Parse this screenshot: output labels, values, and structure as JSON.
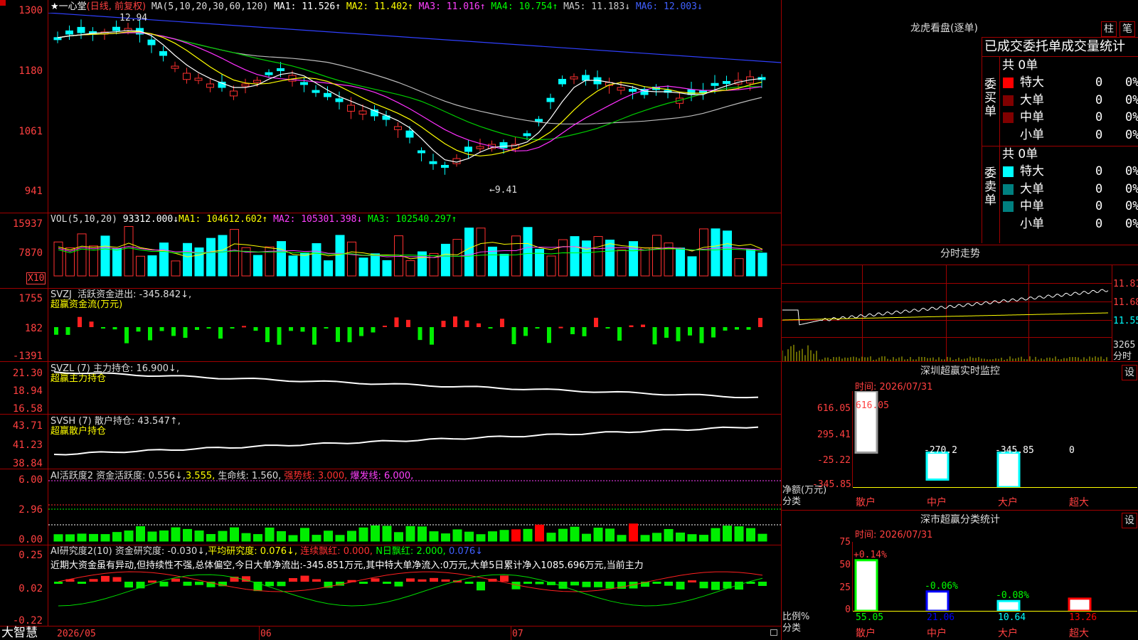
{
  "app_logo": "大智慧",
  "kline": {
    "stock": "★一心堂",
    "period": "(日线, 前复权)",
    "ma_label": "MA(5,10,20,30,60,120)",
    "ma1": "MA1: 11.526↑",
    "ma2": "MA2: 11.402↑",
    "ma3": "MA3: 11.016↑",
    "ma4": "MA4: 10.754↑",
    "ma5": "MA5: 11.183↓",
    "ma6": "MA6: 12.003↓",
    "high_mark": "12.94",
    "low_mark": "←9.41",
    "y_ticks": [
      "1300",
      "1180",
      "1061",
      "941"
    ]
  },
  "vol": {
    "label": "VOL(5,10,20)",
    "value": "93312.000↓",
    "ma1": "MA1: 104612.602↑",
    "ma2": "MA2: 105301.398↓",
    "ma3": "MA3: 102540.297↑",
    "y_ticks": [
      "15937",
      "7870"
    ],
    "unit": "X10"
  },
  "svzj": {
    "label": "SVZJ",
    "title": "活跃资金进出: -345.842↓,",
    "sub": "超赢资金流(万元)",
    "y_ticks": [
      "1755",
      "182",
      "-1391"
    ]
  },
  "svzl": {
    "label": "SVZL (7)",
    "title": "主力持仓: 16.900↓,",
    "sub": "超赢主力持仓",
    "y_ticks": [
      "21.30",
      "18.94",
      "16.58"
    ]
  },
  "svsh": {
    "label": "SVSH (7)",
    "title": "散户持仓: 43.547↑,",
    "sub": "超赢散户持仓",
    "y_ticks": [
      "43.71",
      "41.23",
      "38.84"
    ]
  },
  "ai1": {
    "label": "AI活跃度2",
    "t1": "资金活跃度: 0.556↓,",
    "t2": "3.555,",
    "t3": "生命线: 1.560,",
    "t4": "强势线: 3.000,",
    "t5": "爆发线: 6.000,",
    "y_ticks": [
      "6.00",
      "2.96",
      "0.00"
    ]
  },
  "ai2": {
    "label": "AI研究度2(10)",
    "t1": "资金研究度: -0.030↓,",
    "t2": "平均研究度: 0.076↓,",
    "t3": "连续飘红: 0.000,",
    "t4": "N日飘红: 2.000,",
    "t5": "0.076↓",
    "comment": "近期大资金虽有异动,但持续性不强,总体偏空,今日大单净流出:-345.851万元,其中特大单净流入:0万元,大单5日累计净入1085.696万元,当前主力",
    "y_ticks": [
      "0.25",
      "0.02",
      "-0.22"
    ]
  },
  "x_axis": [
    "2026/05",
    "06",
    "07"
  ],
  "longhu": {
    "title": "龙虎看盘(逐单)",
    "btn1": "柱",
    "btn2": "笔",
    "header": "已成交委托单成交量统计",
    "buy_side": "委买单",
    "sell_side": "委卖单",
    "buy_total": "共 0单",
    "sell_total": "共 0单",
    "buy_rows": [
      {
        "name": "特大",
        "count": "0",
        "pct": "0%",
        "color": "#ff0000"
      },
      {
        "name": "大单",
        "count": "0",
        "pct": "0%",
        "color": "#800000"
      },
      {
        "name": "中单",
        "count": "0",
        "pct": "0%",
        "color": "#800000"
      },
      {
        "name": "小单",
        "count": "0",
        "pct": "0%",
        "color": "#000000"
      }
    ],
    "sell_rows": [
      {
        "name": "特大",
        "count": "0",
        "pct": "0%",
        "color": "#00ffff"
      },
      {
        "name": "大单",
        "count": "0",
        "pct": "0%",
        "color": "#008080"
      },
      {
        "name": "中单",
        "count": "0",
        "pct": "0%",
        "color": "#008080"
      },
      {
        "name": "小单",
        "count": "0",
        "pct": "0%",
        "color": "#000000"
      }
    ]
  },
  "fenshi": {
    "title": "分时走势",
    "prices": [
      "11.81",
      "11.68",
      "11.55"
    ],
    "vol": "3265",
    "vol_unit": "分时"
  },
  "monitor": {
    "title": "深圳超赢实时监控",
    "btn": "设",
    "time": "时间: 2026/07/31",
    "y_ticks": [
      "616.05",
      "295.41",
      "-25.22",
      "-345.85"
    ],
    "ylabel": "净额(万元)",
    "xlabel": "分类",
    "bars": [
      {
        "name": "散户",
        "value": "616.05"
      },
      {
        "name": "中户",
        "value": "-270.2"
      },
      {
        "name": "大户",
        "value": "-345.85"
      },
      {
        "name": "超大",
        "value": "0"
      }
    ]
  },
  "classify": {
    "title": "深市超赢分类统计",
    "btn": "设",
    "time": "时间: 2026/07/31",
    "y_ticks": [
      "75",
      "50",
      "25",
      "0"
    ],
    "ylabel": "比例%",
    "xlabel": "分类",
    "bars": [
      {
        "name": "散户",
        "value": "55.05",
        "change": "+0.14%"
      },
      {
        "name": "中户",
        "value": "21.06",
        "change": "-0.06%"
      },
      {
        "name": "大户",
        "value": "10.64",
        "change": "-0.08%"
      },
      {
        "name": "超大",
        "value": "13.26",
        "change": ""
      }
    ]
  },
  "chart_data": [
    {
      "type": "bar",
      "title": "深圳超赢实时监控",
      "categories": [
        "散户",
        "中户",
        "大户",
        "超大"
      ],
      "values": [
        616.05,
        -270.2,
        -345.85,
        0
      ],
      "ylabel": "净额(万元)",
      "xlabel": "分类",
      "ylim": [
        -345.85,
        616.05
      ]
    },
    {
      "type": "bar",
      "title": "深市超赢分类统计",
      "categories": [
        "散户",
        "中户",
        "大户",
        "超大"
      ],
      "values": [
        55.05,
        21.06,
        10.64,
        13.26
      ],
      "ylabel": "比例%",
      "xlabel": "分类",
      "ylim": [
        0,
        75
      ]
    }
  ]
}
